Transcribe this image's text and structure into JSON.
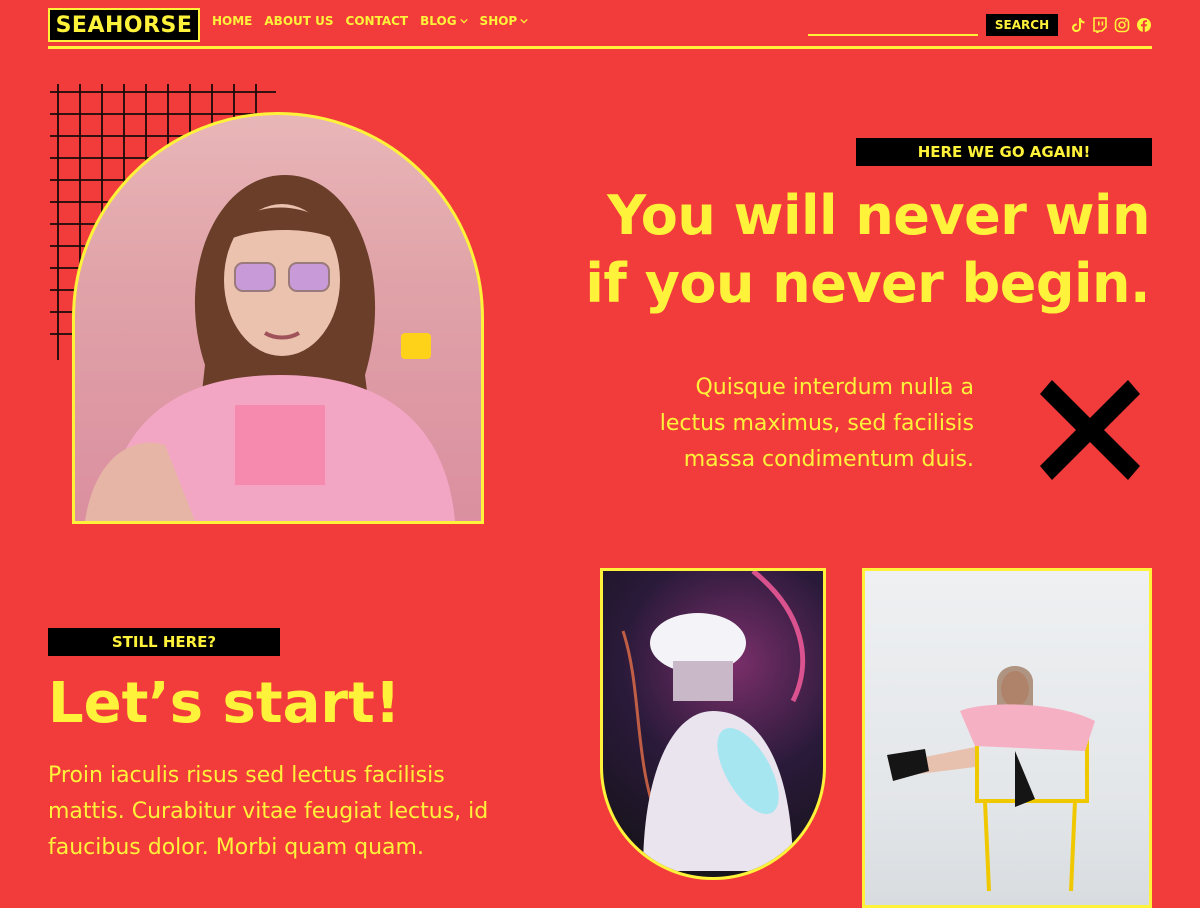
{
  "header": {
    "logo": "SEAHORSE",
    "nav": [
      {
        "label": "HOME",
        "dropdown": false
      },
      {
        "label": "ABOUT US",
        "dropdown": false
      },
      {
        "label": "CONTACT",
        "dropdown": false
      },
      {
        "label": "BLOG",
        "dropdown": true
      },
      {
        "label": "SHOP",
        "dropdown": true
      }
    ],
    "search_placeholder": "",
    "search_button": "SEARCH",
    "social_icons": [
      "tiktok-icon",
      "twitch-icon",
      "instagram-icon",
      "facebook-icon"
    ]
  },
  "hero": {
    "tag": "HERE WE GO AGAIN!",
    "headline_line1": "You will never win",
    "headline_line2": "if you never begin.",
    "sub_line1": "Quisque interdum nulla a",
    "sub_line2": "lectus maximus, sed facilisis",
    "sub_line3": "massa condimentum duis."
  },
  "section2": {
    "tag": "STILL HERE?",
    "heading": "Let’s start!",
    "body_line1": "Proin iaculis risus sed lectus facilisis",
    "body_line2": "mattis. Curabitur vitae feugiat lectus, id",
    "body_line3": "faucibus dolor. Morbi quam quam."
  },
  "colors": {
    "background": "#F23B3B",
    "accent": "#FFF23A",
    "dark": "#000000"
  }
}
